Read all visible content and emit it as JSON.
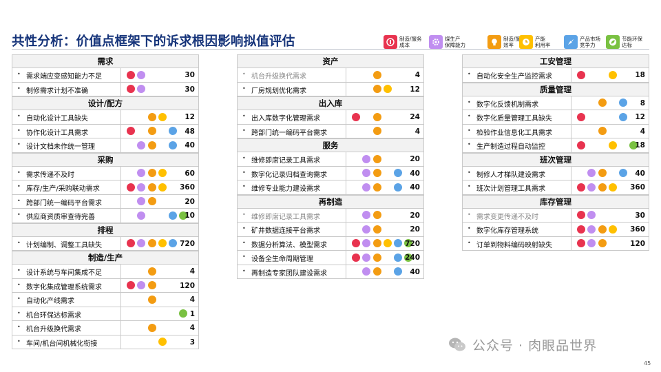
{
  "title": "共性分析：价值点框架下的诉求根因影响拟值评估",
  "colors": {
    "red": "#e8334f",
    "purple": "#c08ef0",
    "orange": "#f39c12",
    "yellow": "#ffc000",
    "blue": "#5ba3e6",
    "green": "#7ac142"
  },
  "legend": [
    {
      "key": "red",
      "label": "制造/服务\n成本",
      "icon": "coin-icon"
    },
    {
      "key": "purple",
      "label": "煤生产\n保障能力",
      "icon": "gear-icon"
    },
    {
      "key": "orange",
      "label": "制造/服务\n效率",
      "icon": "lightbulb-icon"
    },
    {
      "key": "yellow",
      "label": "产能\n利用率",
      "icon": "clock-icon"
    },
    {
      "key": "blue",
      "label": "产品市场\n竞争力",
      "icon": "rocket-icon"
    },
    {
      "key": "green",
      "label": "节能环保\n达标",
      "icon": "leaf-icon"
    }
  ],
  "columns": [
    {
      "groups": [
        {
          "name": "需求",
          "rows": [
            {
              "text": "需求端应变感知能力不足",
              "dots": [
                "red",
                "purple"
              ],
              "value": "30"
            },
            {
              "text": "制修需求计划不准确",
              "dots": [
                "red",
                "purple"
              ],
              "value": "30"
            }
          ]
        },
        {
          "name": "设计/配方",
          "rows": [
            {
              "text": "自动化设计工具缺失",
              "dots": [
                "orange",
                "yellow"
              ],
              "value": "12"
            },
            {
              "text": "协作化设计工具需求",
              "dots": [
                "red",
                "orange",
                "blue"
              ],
              "value": "48"
            },
            {
              "text": "设计文档未作统一管理",
              "dots": [
                "purple",
                "orange",
                "blue"
              ],
              "value": "40"
            }
          ]
        },
        {
          "name": "采购",
          "rows": [
            {
              "text": "需求传递不及时",
              "dots": [
                "purple",
                "orange",
                "yellow"
              ],
              "value": "60"
            },
            {
              "text": "库存/生产/采购联动需求",
              "dots": [
                "red",
                "purple",
                "orange",
                "yellow"
              ],
              "value": "360"
            },
            {
              "text": "跨部门统一编码平台需求",
              "dots": [
                "purple",
                "orange"
              ],
              "value": "20"
            },
            {
              "text": "供应商资质审查待完善",
              "dots": [
                "purple",
                "blue",
                "green"
              ],
              "value": "10"
            }
          ]
        },
        {
          "name": "排程",
          "rows": [
            {
              "text": "计划编制、调整工具缺失",
              "dots": [
                "red",
                "purple",
                "orange",
                "yellow",
                "blue"
              ],
              "value": "720"
            }
          ]
        },
        {
          "name": "制造/生产",
          "rows": [
            {
              "text": "设计系统与车间集成不足",
              "dots": [
                "orange"
              ],
              "value": "4"
            },
            {
              "text": "数字化集成管理系统需求",
              "dots": [
                "red",
                "purple",
                "orange"
              ],
              "value": "120"
            },
            {
              "text": "自动化产线需求",
              "dots": [
                "orange"
              ],
              "value": "4"
            },
            {
              "text": "机台环保达标需求",
              "dots": [
                "green"
              ],
              "value": "1"
            },
            {
              "text": "机台升级换代需求",
              "dots": [
                "orange"
              ],
              "value": "4"
            },
            {
              "text": "车间/机台间机械化衔接",
              "dots": [
                "yellow"
              ],
              "value": "3"
            }
          ]
        }
      ]
    },
    {
      "groups": [
        {
          "name": "资产",
          "rows": [
            {
              "text": "机台升级换代需求",
              "dots": [
                "orange"
              ],
              "value": "4",
              "grey": true
            },
            {
              "text": "厂房规划优化需求",
              "dots": [
                "orange",
                "yellow"
              ],
              "value": "12"
            }
          ]
        },
        {
          "name": "出入库",
          "rows": [
            {
              "text": "出入库数字化管理需求",
              "dots": [
                "red",
                "orange"
              ],
              "value": "24"
            },
            {
              "text": "跨部门统一编码平台需求",
              "dots": [
                "orange"
              ],
              "value": "4"
            }
          ]
        },
        {
          "name": "服务",
          "rows": [
            {
              "text": "维修即席记录工具需求",
              "dots": [
                "purple",
                "orange"
              ],
              "value": "20"
            },
            {
              "text": "数字化记录归档查询需求",
              "dots": [
                "purple",
                "orange",
                "blue"
              ],
              "value": "40"
            },
            {
              "text": "维修专业能力建设需求",
              "dots": [
                "purple",
                "orange",
                "blue"
              ],
              "value": "40"
            }
          ]
        },
        {
          "name": "再制造",
          "rows": [
            {
              "text": "维修即席记录工具需求",
              "dots": [
                "purple",
                "orange"
              ],
              "value": "20",
              "grey": true
            },
            {
              "text": "矿井数据连接平台需求",
              "dots": [
                "purple",
                "orange"
              ],
              "value": "20"
            },
            {
              "text": "数据分析算法、模型需求",
              "dots": [
                "red",
                "purple",
                "orange",
                "yellow",
                "blue",
                "green"
              ],
              "value": "720"
            },
            {
              "text": "设备全生命周期管理",
              "dots": [
                "red",
                "purple",
                "orange",
                "blue",
                "green"
              ],
              "value": "240"
            },
            {
              "text": "再制造专家团队建设需求",
              "dots": [
                "purple",
                "orange",
                "blue"
              ],
              "value": "40"
            }
          ]
        }
      ]
    },
    {
      "groups": [
        {
          "name": "工安管理",
          "rows": [
            {
              "text": "自动化安全生产监控需求",
              "dots": [
                "red",
                "yellow"
              ],
              "value": "18"
            }
          ]
        },
        {
          "name": "质量管理",
          "rows": [
            {
              "text": "数字化反馈机制需求",
              "dots": [
                "orange",
                "blue"
              ],
              "value": "8"
            },
            {
              "text": "数字化质量管理工具缺失",
              "dots": [
                "red",
                "blue"
              ],
              "value": "12"
            },
            {
              "text": "检验作业信息化工具需求",
              "dots": [
                "orange"
              ],
              "value": "4"
            },
            {
              "text": "生产制造过程自动监控",
              "dots": [
                "red",
                "yellow",
                "green"
              ],
              "value": "18"
            }
          ]
        },
        {
          "name": "班次管理",
          "rows": [
            {
              "text": "制修人才梯队建设需求",
              "dots": [
                "purple",
                "orange",
                "blue"
              ],
              "value": "40"
            },
            {
              "text": "班次计划管理工具需求",
              "dots": [
                "red",
                "purple",
                "orange",
                "yellow"
              ],
              "value": "360"
            }
          ]
        },
        {
          "name": "库存管理",
          "rows": [
            {
              "text": "需求变更传递不及时",
              "dots": [
                "red",
                "purple"
              ],
              "value": "30",
              "grey": true
            },
            {
              "text": "数字化库存管理系统",
              "dots": [
                "red",
                "purple",
                "orange",
                "yellow"
              ],
              "value": "360"
            },
            {
              "text": "订单到物料编码映射缺失",
              "dots": [
                "red",
                "purple",
                "orange"
              ],
              "value": "120"
            }
          ]
        }
      ]
    }
  ],
  "watermark": "公众号 · 肉眼品世界",
  "page_number": "45"
}
